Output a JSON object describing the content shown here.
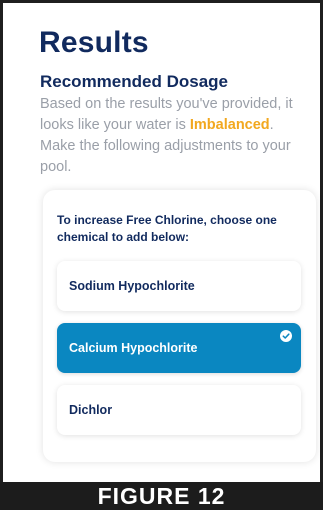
{
  "header": {
    "title": "Results"
  },
  "section": {
    "title": "Recommended Dosage",
    "description_before": "Based on the results you've provided, it looks like your water is ",
    "status_word": "Imbalanced",
    "description_after": ". Make the following adjustments to your pool."
  },
  "card": {
    "prompt": "To increase Free Chlorine, choose one chemical to add below:",
    "options": [
      {
        "label": "Sodium Hypochlorite",
        "selected": false
      },
      {
        "label": "Calcium Hypochlorite",
        "selected": true
      },
      {
        "label": "Dichlor",
        "selected": false
      }
    ],
    "selected_icon": "check-circle-icon"
  },
  "colors": {
    "title": "#112a5e",
    "status": "#f2a81f",
    "selected_option": "#0a87c1",
    "description": "#9a9fa8"
  },
  "figure_caption": "FIGURE 12"
}
